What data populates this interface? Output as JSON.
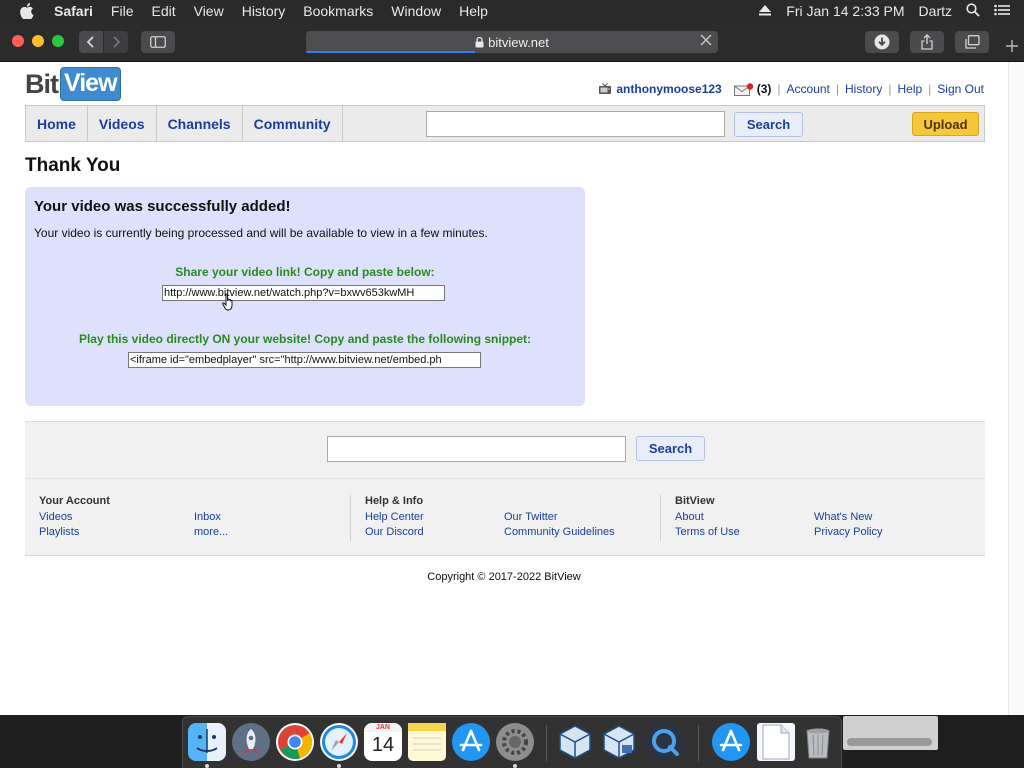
{
  "menubar": {
    "app": "Safari",
    "items": [
      "File",
      "Edit",
      "View",
      "History",
      "Bookmarks",
      "Window",
      "Help"
    ],
    "datetime": "Fri Jan 14  2:33 PM",
    "user": "Dartz"
  },
  "browser": {
    "url": "bitview.net",
    "load_progress": 0.41
  },
  "site": {
    "logo_part1": "Bit",
    "logo_part2": "View",
    "username": "anthonymoose123",
    "inbox_count": "(3)",
    "links": [
      "Account",
      "History",
      "Help",
      "Sign Out"
    ],
    "nav_tabs": [
      "Home",
      "Videos",
      "Channels",
      "Community"
    ],
    "search_placeholder": "",
    "search_label": "Search",
    "upload_label": "Upload"
  },
  "main": {
    "title": "Thank You",
    "success_heading": "Your video was successfully added!",
    "processing_text": "Your video is currently being processed and will be available to view in a few minutes.",
    "share_label": "Share your video link! Copy and paste below:",
    "share_url": "http://www.bitview.net/watch.php?v=bxwv653kwMH",
    "embed_label": "Play this video directly ON your website! Copy and paste the following snippet:",
    "embed_code": "<iframe id=\"embedplayer\" src=\"http://www.bitview.net/embed.ph"
  },
  "footer": {
    "search_label": "Search",
    "your_account": {
      "heading": "Your Account",
      "col1": [
        "Videos",
        "Playlists"
      ],
      "col2": [
        "Inbox",
        "more..."
      ]
    },
    "help_info": {
      "heading": "Help & Info",
      "col1": [
        "Help Center",
        "Our Discord"
      ],
      "col2": [
        "Our Twitter",
        "Community Guidelines"
      ]
    },
    "bitview": {
      "heading": "BitView",
      "col1": [
        "About",
        "Terms of Use"
      ],
      "col2": [
        "What's New",
        "Privacy Policy"
      ]
    },
    "copyright": "Copyright © 2017-2022 BitView"
  },
  "dock": {
    "apps": [
      "finder-icon",
      "launchpad-icon",
      "chrome-icon",
      "safari-icon",
      "calendar-icon",
      "notes-icon",
      "app-store-icon",
      "system-preferences-icon",
      "virtualbox-icon",
      "virtualbox-vm-icon",
      "quicktime-icon",
      "app-store-downloads-icon",
      "document-icon",
      "trash-icon"
    ],
    "calendar_month": "JAN",
    "calendar_day": "14"
  },
  "colors": {
    "link": "#1a3e9c",
    "success_bg": "#dde1fb",
    "green_text": "#2b8a1e",
    "upload": "#f6c73a"
  }
}
